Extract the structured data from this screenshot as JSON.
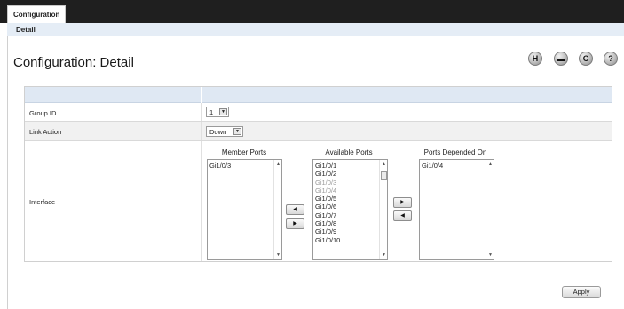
{
  "nav": {
    "active_tab": "Configuration",
    "sub_item": "Detail"
  },
  "page": {
    "title": "Configuration: Detail"
  },
  "toolbar": {
    "icons": [
      "save-icon",
      "print-icon",
      "refresh-icon",
      "help-icon"
    ],
    "save_glyph": "H",
    "print_glyph": "▬",
    "refresh_glyph": "C",
    "help_glyph": "?"
  },
  "form": {
    "group_id": {
      "label": "Group ID",
      "value": "1"
    },
    "link_action": {
      "label": "Link Action",
      "value": "Down"
    },
    "interface": {
      "label": "Interface",
      "member_ports": {
        "title": "Member Ports",
        "items": [
          "Gi1/0/3"
        ]
      },
      "available_ports": {
        "title": "Available Ports",
        "items": [
          {
            "text": "Gi1/0/1",
            "disabled": false
          },
          {
            "text": "Gi1/0/2",
            "disabled": false
          },
          {
            "text": "Gi1/0/3",
            "disabled": true
          },
          {
            "text": "Gi1/0/4",
            "disabled": true
          },
          {
            "text": "Gi1/0/5",
            "disabled": false
          },
          {
            "text": "Gi1/0/6",
            "disabled": false
          },
          {
            "text": "Gi1/0/7",
            "disabled": false
          },
          {
            "text": "Gi1/0/8",
            "disabled": false
          },
          {
            "text": "Gi1/0/9",
            "disabled": false
          },
          {
            "text": "Gi1/0/10",
            "disabled": false
          }
        ]
      },
      "depended_ports": {
        "title": "Ports Depended On",
        "items": [
          "Gi1/0/4"
        ]
      }
    }
  },
  "buttons": {
    "apply": "Apply",
    "move_left_glyph": "◀",
    "move_right_glyph": "▶"
  },
  "scroll": {
    "up_glyph": "▲",
    "down_glyph": "▼"
  },
  "colors": {
    "header_bar": "#1f1f1f",
    "subnav_bg": "#e5edf6",
    "table_header_bg": "#dfe8f3"
  }
}
